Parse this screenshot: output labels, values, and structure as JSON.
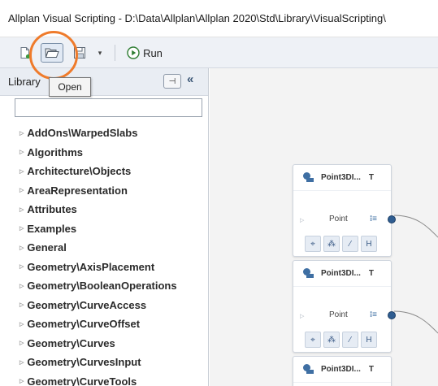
{
  "window": {
    "title": "Allplan Visual Scripting - D:\\Data\\Allplan\\Allplan 2020\\Std\\Library\\VisualScripting\\"
  },
  "toolbar": {
    "new_icon": "new-file-icon",
    "open_icon": "folder-open-icon",
    "save_icon": "save-icon",
    "dropdown_glyph": "▾",
    "run_label": "Run",
    "highlight_color": "#ef7b2b"
  },
  "tooltip": {
    "text": "Open"
  },
  "library": {
    "title": "Library",
    "pin_glyph": "⊣",
    "collapse_glyph": "«",
    "search_value": "",
    "items": [
      "AddOns\\WarpedSlabs",
      "Algorithms",
      "Architecture\\Objects",
      "AreaRepresentation",
      "Attributes",
      "Examples",
      "General",
      "Geometry\\AxisPlacement",
      "Geometry\\BooleanOperations",
      "Geometry\\CurveAccess",
      "Geometry\\CurveOffset",
      "Geometry\\Curves",
      "Geometry\\CurvesInput",
      "Geometry\\CurveTools"
    ]
  },
  "canvas": {
    "nodes": [
      {
        "title": "Point3DI...",
        "type": "T",
        "port_label": "Point",
        "port_glyph": "⁝≡",
        "buttons": [
          "⌖",
          "⁂",
          "⁄",
          "H"
        ]
      },
      {
        "title": "Point3DI...",
        "type": "T",
        "port_label": "Point",
        "port_glyph": "⁝≡",
        "buttons": [
          "⌖",
          "⁂",
          "⁄",
          "H"
        ]
      },
      {
        "title": "Point3DI...",
        "type": "T"
      }
    ],
    "accent_color": "#2f5d91"
  }
}
